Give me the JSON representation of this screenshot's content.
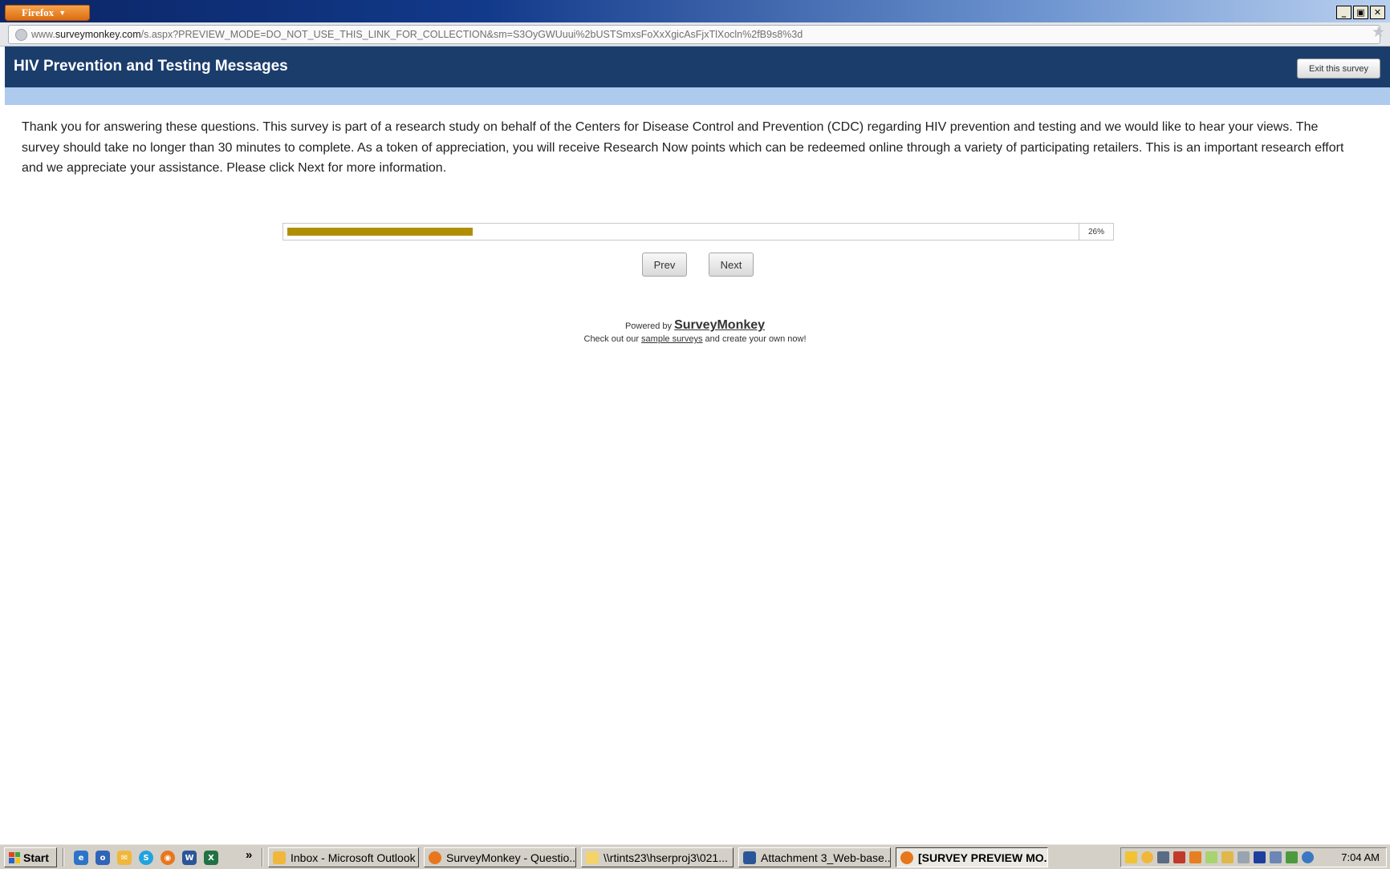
{
  "browser": {
    "menu_label": "Firefox",
    "url_prefix": "www.",
    "url_domain": "surveymonkey.com",
    "url_path": "/s.aspx?PREVIEW_MODE=DO_NOT_USE_THIS_LINK_FOR_COLLECTION&sm=S3OyGWUuui%2bUSTSmxsFoXxXgicAsFjxTlXocln%2fB9s8%3d",
    "window_controls": {
      "minimize": "_",
      "restore": "▣",
      "close": "✕"
    }
  },
  "survey": {
    "title": "HIV Prevention and Testing Messages",
    "exit_label": "Exit this survey",
    "intro": "Thank you for answering these questions. This survey is part of a research study on behalf of the Centers for Disease Control and Prevention (CDC) regarding HIV prevention and testing and we would like to hear your views. The survey should take no longer than 30 minutes to complete. As a token of appreciation, you will receive Research Now points which can be redeemed online through a variety of participating retailers. This is an important research effort and we appreciate your assistance. Please click Next for more information.",
    "progress_label": "26%",
    "progress_fraction": 0.235,
    "prev_label": "Prev",
    "next_label": "Next",
    "powered_by": "Powered by",
    "brand": "SurveyMonkey",
    "checkout_prefix": "Check out our",
    "checkout_link": "sample surveys",
    "checkout_suffix": "and create your own now!"
  },
  "taskbar": {
    "start_label": "Start",
    "quick_chevron": "»",
    "quick_launch": [
      "internet-explorer-icon",
      "outlook-icon",
      "mail-icon",
      "skype-icon",
      "firefox-icon",
      "word-icon",
      "excel-icon"
    ],
    "tasks": [
      {
        "label": "Inbox - Microsoft Outlook",
        "icon": "outlook-icon",
        "active": false
      },
      {
        "label": "SurveyMonkey - Questio...",
        "icon": "firefox-icon",
        "active": false
      },
      {
        "label": "\\\\rtints23\\hserproj3\\021...",
        "icon": "folder-icon",
        "active": false
      },
      {
        "label": "Attachment 3_Web-base...",
        "icon": "word-icon",
        "active": false
      },
      {
        "label": "[SURVEY PREVIEW MO...",
        "icon": "firefox-icon",
        "active": true
      }
    ],
    "clock": "7:04 AM"
  },
  "colors": {
    "header": "#1b3d6b",
    "band": "#aecaed",
    "progress_fill": "#b08f05",
    "firefox_orange": "#e8761c"
  }
}
